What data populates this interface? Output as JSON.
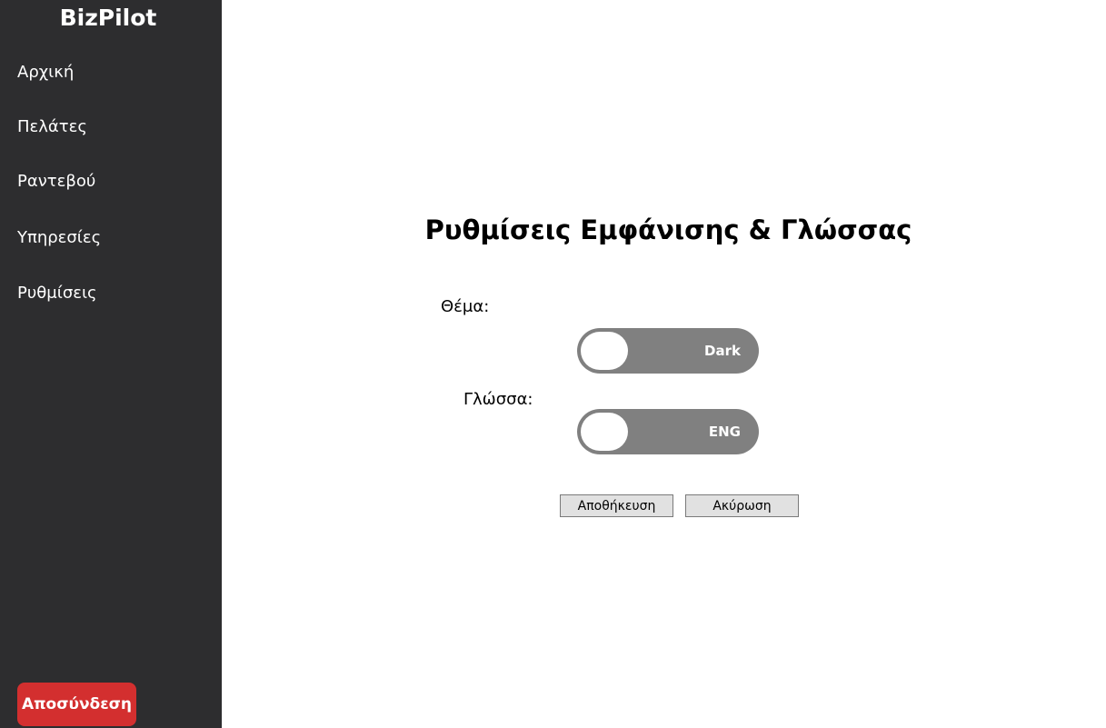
{
  "app": {
    "brand": "BizPilot"
  },
  "sidebar": {
    "items": [
      {
        "label": "Αρχική"
      },
      {
        "label": "Πελάτες"
      },
      {
        "label": "Ραντεβού"
      },
      {
        "label": "Υπηρεσίες"
      },
      {
        "label": "Ρυθμίσεις"
      }
    ],
    "logout_label": "Αποσύνδεση"
  },
  "settings": {
    "title": "Ρυθμίσεις Εμφάνισης & Γλώσσας",
    "theme": {
      "label": "Θέμα:",
      "value": "Dark"
    },
    "language": {
      "label": "Γλώσσα:",
      "value": "ENG"
    },
    "save_label": "Αποθήκευση",
    "cancel_label": "Ακύρωση"
  },
  "colors": {
    "sidebar_bg": "#2d2d2f",
    "logout_bg": "#d32f2f",
    "toggle_bg": "#808080"
  }
}
